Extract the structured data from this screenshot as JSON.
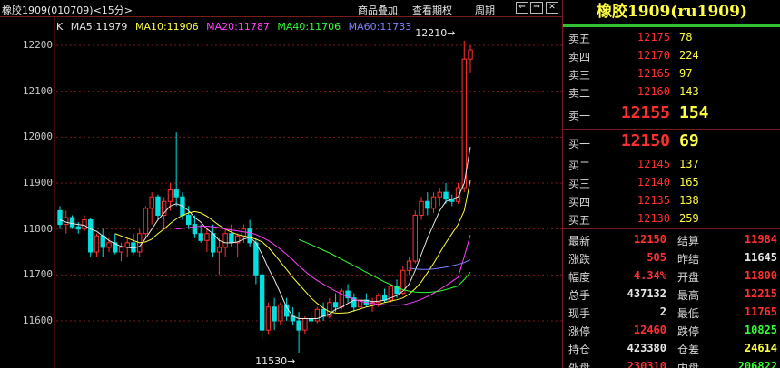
{
  "header": {
    "title": "橡胶1909(010709)<15分>",
    "buttons": [
      "商品叠加",
      "查看期权",
      "周期"
    ],
    "window_buttons": [
      "⇐",
      "⇒",
      "✕"
    ]
  },
  "ma_legend": {
    "k": "K",
    "items": [
      {
        "text": "MA5:11979",
        "color": "#e8e8e8"
      },
      {
        "text": "MA10:11906",
        "color": "#ffff40"
      },
      {
        "text": "MA20:11787",
        "color": "#ff40ff"
      },
      {
        "text": "MA40:11706",
        "color": "#30ff30"
      },
      {
        "text": "MA60:11733",
        "color": "#8080ff"
      }
    ]
  },
  "annotations": {
    "high": "12210→",
    "low": "11530→"
  },
  "colors": {
    "up": "#ff3030",
    "down": "#00e0e0",
    "grid": "#7a1a1a",
    "title": "#ffff40"
  },
  "chart_data": {
    "type": "candlestick",
    "y_ticks": [
      12200,
      12100,
      12000,
      11900,
      11800,
      11700,
      11600
    ],
    "ylim": [
      11500,
      12250
    ],
    "candles": [
      [
        11840,
        11850,
        11800,
        11810
      ],
      [
        11810,
        11840,
        11790,
        11825
      ],
      [
        11825,
        11830,
        11800,
        11805
      ],
      [
        11805,
        11815,
        11790,
        11800
      ],
      [
        11800,
        11830,
        11795,
        11820
      ],
      [
        11820,
        11825,
        11740,
        11750
      ],
      [
        11750,
        11790,
        11740,
        11785
      ],
      [
        11785,
        11800,
        11740,
        11760
      ],
      [
        11760,
        11780,
        11750,
        11770
      ],
      [
        11770,
        11790,
        11745,
        11750
      ],
      [
        11750,
        11770,
        11730,
        11760
      ],
      [
        11760,
        11780,
        11740,
        11770
      ],
      [
        11770,
        11790,
        11745,
        11750
      ],
      [
        11750,
        11800,
        11740,
        11790
      ],
      [
        11790,
        11850,
        11780,
        11845
      ],
      [
        11845,
        11880,
        11810,
        11870
      ],
      [
        11870,
        11875,
        11820,
        11830
      ],
      [
        11830,
        11870,
        11800,
        11860
      ],
      [
        11860,
        11900,
        11840,
        11885
      ],
      [
        11885,
        12010,
        11850,
        11870
      ],
      [
        11870,
        11880,
        11820,
        11830
      ],
      [
        11830,
        11850,
        11800,
        11810
      ],
      [
        11810,
        11830,
        11780,
        11790
      ],
      [
        11790,
        11810,
        11770,
        11775
      ],
      [
        11775,
        11800,
        11750,
        11790
      ],
      [
        11790,
        11810,
        11740,
        11750
      ],
      [
        11750,
        11780,
        11700,
        11760
      ],
      [
        11760,
        11800,
        11740,
        11790
      ],
      [
        11790,
        11810,
        11760,
        11770
      ],
      [
        11770,
        11790,
        11740,
        11785
      ],
      [
        11785,
        11810,
        11770,
        11800
      ],
      [
        11800,
        11820,
        11760,
        11770
      ],
      [
        11770,
        11780,
        11680,
        11700
      ],
      [
        11700,
        11720,
        11560,
        11580
      ],
      [
        11580,
        11640,
        11570,
        11630
      ],
      [
        11630,
        11650,
        11580,
        11600
      ],
      [
        11600,
        11640,
        11590,
        11635
      ],
      [
        11635,
        11650,
        11600,
        11610
      ],
      [
        11610,
        11630,
        11590,
        11600
      ],
      [
        11600,
        11620,
        11530,
        11580
      ],
      [
        11580,
        11610,
        11570,
        11605
      ],
      [
        11605,
        11620,
        11590,
        11600
      ],
      [
        11600,
        11630,
        11595,
        11625
      ],
      [
        11625,
        11640,
        11600,
        11610
      ],
      [
        11610,
        11650,
        11605,
        11640
      ],
      [
        11640,
        11660,
        11620,
        11630
      ],
      [
        11630,
        11670,
        11625,
        11665
      ],
      [
        11665,
        11680,
        11640,
        11650
      ],
      [
        11650,
        11660,
        11620,
        11630
      ],
      [
        11630,
        11650,
        11615,
        11645
      ],
      [
        11645,
        11660,
        11630,
        11635
      ],
      [
        11635,
        11650,
        11620,
        11640
      ],
      [
        11640,
        11660,
        11630,
        11655
      ],
      [
        11655,
        11670,
        11640,
        11645
      ],
      [
        11645,
        11680,
        11640,
        11675
      ],
      [
        11675,
        11690,
        11650,
        11660
      ],
      [
        11660,
        11720,
        11655,
        11710
      ],
      [
        11710,
        11740,
        11700,
        11730
      ],
      [
        11730,
        11840,
        11725,
        11830
      ],
      [
        11830,
        11870,
        11820,
        11860
      ],
      [
        11860,
        11880,
        11830,
        11845
      ],
      [
        11845,
        11880,
        11835,
        11870
      ],
      [
        11870,
        11890,
        11850,
        11880
      ],
      [
        11880,
        11900,
        11855,
        11865
      ],
      [
        11865,
        11875,
        11850,
        11860
      ],
      [
        11860,
        11900,
        11855,
        11890
      ],
      [
        11890,
        12210,
        11880,
        12170
      ],
      [
        12170,
        12200,
        12140,
        12190
      ]
    ],
    "ma_lines": {
      "MA5": [
        11820,
        11815,
        11812,
        11810,
        11808,
        11800,
        11795,
        11785,
        11775,
        11768,
        11762,
        11760,
        11758,
        11762,
        11780,
        11800,
        11820,
        11835,
        11850,
        11855,
        11850,
        11840,
        11825,
        11815,
        11800,
        11790,
        11775,
        11770,
        11770,
        11772,
        11778,
        11782,
        11770,
        11745,
        11715,
        11690,
        11660,
        11630,
        11610,
        11605,
        11605,
        11605,
        11605,
        11610,
        11615,
        11625,
        11630,
        11638,
        11645,
        11645,
        11645,
        11642,
        11643,
        11645,
        11650,
        11655,
        11665,
        11680,
        11710,
        11745,
        11780,
        11810,
        11840,
        11860,
        11865,
        11870,
        11900,
        11979
      ],
      "MA10": [
        null,
        null,
        null,
        null,
        null,
        null,
        null,
        null,
        null,
        11790,
        11785,
        11780,
        11775,
        11770,
        11772,
        11778,
        11790,
        11800,
        11812,
        11822,
        11830,
        11835,
        11838,
        11835,
        11828,
        11818,
        11808,
        11800,
        11793,
        11788,
        11785,
        11782,
        11778,
        11772,
        11760,
        11745,
        11728,
        11712,
        11695,
        11680,
        11665,
        11650,
        11638,
        11628,
        11620,
        11617,
        11617,
        11618,
        11622,
        11626,
        11630,
        11633,
        11636,
        11640,
        11643,
        11646,
        11650,
        11658,
        11670,
        11685,
        11705,
        11725,
        11748,
        11770,
        11790,
        11810,
        11840,
        11906
      ],
      "MA20": [
        null,
        null,
        null,
        null,
        null,
        null,
        null,
        null,
        null,
        null,
        null,
        null,
        null,
        null,
        null,
        null,
        null,
        null,
        null,
        11800,
        11802,
        11803,
        11805,
        11806,
        11806,
        11805,
        11803,
        11800,
        11798,
        11796,
        11794,
        11792,
        11788,
        11782,
        11775,
        11766,
        11756,
        11745,
        11733,
        11720,
        11708,
        11697,
        11688,
        11680,
        11672,
        11665,
        11658,
        11652,
        11647,
        11643,
        11640,
        11638,
        11636,
        11635,
        11634,
        11634,
        11635,
        11638,
        11642,
        11647,
        11653,
        11660,
        11668,
        11677,
        11686,
        11695,
        11740,
        11787
      ],
      "MA40": [
        null,
        null,
        null,
        null,
        null,
        null,
        null,
        null,
        null,
        null,
        null,
        null,
        null,
        null,
        null,
        null,
        null,
        null,
        null,
        null,
        null,
        null,
        null,
        null,
        null,
        null,
        null,
        null,
        null,
        null,
        null,
        null,
        null,
        null,
        null,
        null,
        null,
        null,
        null,
        11777,
        11772,
        11766,
        11760,
        11754,
        11748,
        11741,
        11734,
        11727,
        11720,
        11713,
        11706,
        11699,
        11692,
        11685,
        11679,
        11673,
        11668,
        11665,
        11663,
        11662,
        11662,
        11663,
        11665,
        11668,
        11672,
        11676,
        11690,
        11706
      ],
      "MA60": [
        null,
        null,
        null,
        null,
        null,
        null,
        null,
        null,
        null,
        null,
        null,
        null,
        null,
        null,
        null,
        null,
        null,
        null,
        null,
        null,
        null,
        null,
        null,
        null,
        null,
        null,
        null,
        null,
        null,
        null,
        null,
        null,
        null,
        null,
        null,
        null,
        null,
        null,
        null,
        null,
        null,
        null,
        null,
        null,
        null,
        null,
        null,
        null,
        null,
        null,
        null,
        null,
        null,
        null,
        null,
        null,
        null,
        11715,
        11713,
        11712,
        11712,
        11713,
        11715,
        11717,
        11720,
        11723,
        11727,
        11733
      ]
    }
  },
  "quote_panel": {
    "title": "橡胶1909(ru1909)",
    "asks": [
      {
        "label": "卖五",
        "price": "12175",
        "volume": "78"
      },
      {
        "label": "卖四",
        "price": "12170",
        "volume": "224"
      },
      {
        "label": "卖三",
        "price": "12165",
        "volume": "97"
      },
      {
        "label": "卖二",
        "price": "12160",
        "volume": "143"
      }
    ],
    "best_ask": {
      "label": "卖一",
      "price": "12155",
      "volume": "154"
    },
    "best_bid": {
      "label": "买一",
      "price": "12150",
      "volume": "69"
    },
    "bids": [
      {
        "label": "买二",
        "price": "12145",
        "volume": "137"
      },
      {
        "label": "买三",
        "price": "12140",
        "volume": "165"
      },
      {
        "label": "买四",
        "price": "12135",
        "volume": "138"
      },
      {
        "label": "买五",
        "price": "12130",
        "volume": "259"
      }
    ],
    "stats": [
      {
        "l1": "最新",
        "v1": "12150",
        "c1": "red",
        "l2": "结算",
        "v2": "11984",
        "c2": "red"
      },
      {
        "l1": "涨跌",
        "v1": "505",
        "c1": "red",
        "l2": "昨结",
        "v2": "11645",
        "c2": "white"
      },
      {
        "l1": "幅度",
        "v1": "4.34%",
        "c1": "red",
        "l2": "开盘",
        "v2": "11800",
        "c2": "red"
      },
      {
        "l1": "总手",
        "v1": "437132",
        "c1": "white",
        "l2": "最高",
        "v2": "12215",
        "c2": "red"
      },
      {
        "l1": "现手",
        "v1": "2",
        "c1": "white",
        "l2": "最低",
        "v2": "11765",
        "c2": "red"
      },
      {
        "l1": "涨停",
        "v1": "12460",
        "c1": "red",
        "l2": "跌停",
        "v2": "10825",
        "c2": "green"
      },
      {
        "l1": "持仓",
        "v1": "423380",
        "c1": "white",
        "l2": "仓差",
        "v2": "24614",
        "c2": "yellow"
      },
      {
        "l1": "外盘",
        "v1": "230310",
        "c1": "red",
        "l2": "内盘",
        "v2": "206822",
        "c2": "green"
      }
    ]
  }
}
